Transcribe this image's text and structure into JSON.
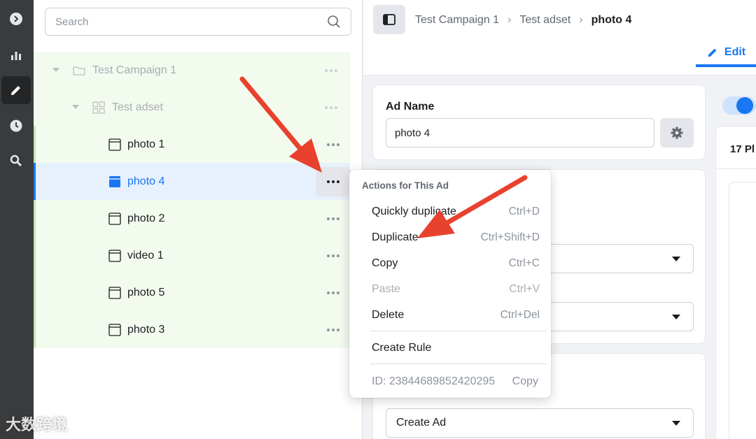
{
  "search": {
    "placeholder": "Search"
  },
  "tree": {
    "campaign": {
      "label": "Test Campaign 1"
    },
    "adset": {
      "label": "Test adset"
    },
    "ads": [
      {
        "label": "photo 1"
      },
      {
        "label": "photo 4"
      },
      {
        "label": "photo 2"
      },
      {
        "label": "video 1"
      },
      {
        "label": "photo 5"
      },
      {
        "label": "photo 3"
      }
    ]
  },
  "breadcrumb": {
    "campaign": "Test Campaign 1",
    "adset": "Test adset",
    "ad": "photo 4"
  },
  "edit_tab": "Edit",
  "ad_name": {
    "label": "Ad Name",
    "value": "photo 4"
  },
  "create_ad_select": "Create Ad",
  "placements_label": "17 Pl",
  "menu": {
    "title": "Actions for This Ad",
    "items": [
      {
        "label": "Quickly duplicate",
        "shortcut": "Ctrl+D"
      },
      {
        "label": "Duplicate",
        "shortcut": "Ctrl+Shift+D"
      },
      {
        "label": "Copy",
        "shortcut": "Ctrl+C"
      },
      {
        "label": "Paste",
        "shortcut": "Ctrl+V"
      },
      {
        "label": "Delete",
        "shortcut": "Ctrl+Del"
      }
    ],
    "create_rule": "Create Rule",
    "id_text": "ID: 23844689852420295",
    "copy_id": "Copy"
  },
  "watermark": "大数跨境",
  "colors": {
    "accent": "#1877f2",
    "annotation_arrow": "#e8412d",
    "rail": "#3a3b3c"
  }
}
